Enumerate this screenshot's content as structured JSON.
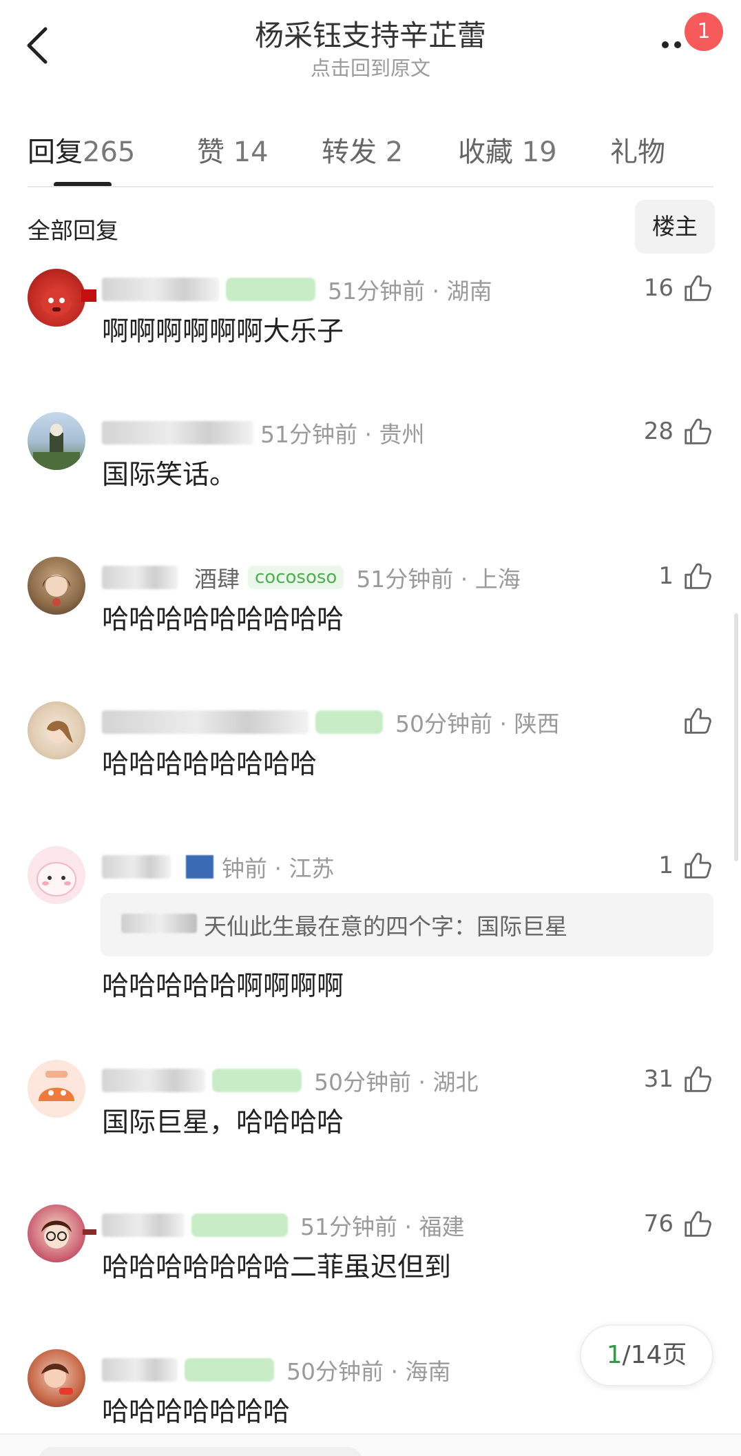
{
  "header": {
    "title": "杨采钰支持辛芷蕾",
    "subtitle": "点击回到原文",
    "notification_count": "1"
  },
  "tabs": [
    {
      "label": "回复",
      "count": "265",
      "active": true
    },
    {
      "label": "赞",
      "count": "14"
    },
    {
      "label": "转发",
      "count": "2"
    },
    {
      "label": "收藏",
      "count": "19"
    },
    {
      "label": "礼物",
      "count": ""
    }
  ],
  "filter": {
    "label": "全部回复",
    "op_button": "楼主"
  },
  "comments": [
    {
      "time_loc": "51分钟前 · 湖南",
      "likes": "16",
      "text": "啊啊啊啊啊啊大乐子"
    },
    {
      "time_loc": "51分钟前 · 贵州",
      "likes": "28",
      "text": "国际笑话。"
    },
    {
      "partial_name": "酒肆",
      "level_tag": "cocososo",
      "time_loc": "51分钟前 · 上海",
      "likes": "1",
      "text": "哈哈哈哈哈哈哈哈哈"
    },
    {
      "time_loc": "50分钟前 · 陕西",
      "likes": "",
      "text": "哈哈哈哈哈哈哈哈"
    },
    {
      "time_loc": "钟前 · 江苏",
      "likes": "1",
      "quote": "天仙此生最在意的四个字：国际巨星",
      "text": "哈哈哈哈哈啊啊啊啊"
    },
    {
      "time_loc": "50分钟前 · 湖北",
      "likes": "31",
      "text": "国际巨星，哈哈哈哈"
    },
    {
      "time_loc": "51分钟前 · 福建",
      "likes": "76",
      "text": "哈哈哈哈哈哈哈二菲虽迟但到"
    },
    {
      "time_loc": "50分钟前 · 海南",
      "likes": "",
      "text": "哈哈哈哈哈哈哈"
    }
  ],
  "pager": {
    "current": "1",
    "total": "/14页"
  },
  "colors": {
    "accent_green": "#2e9d4a",
    "badge_red": "#f65a5a",
    "tag_green": "#c8ecc6"
  },
  "icons": [
    "back-arrow-icon",
    "more-dots-icon",
    "thumb-up-icon"
  ]
}
